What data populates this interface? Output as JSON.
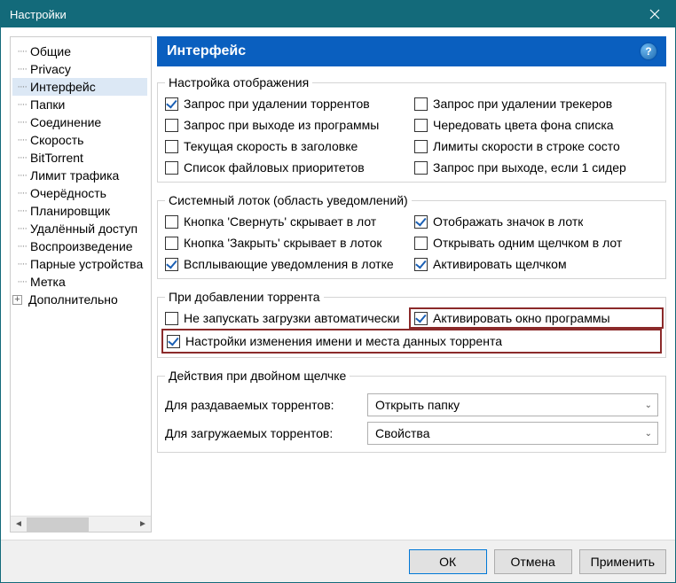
{
  "window": {
    "title": "Настройки"
  },
  "sidebar": {
    "items": [
      {
        "label": "Общие",
        "expandable": false
      },
      {
        "label": "Privacy",
        "expandable": false
      },
      {
        "label": "Интерфейс",
        "expandable": false,
        "selected": true
      },
      {
        "label": "Папки",
        "expandable": false
      },
      {
        "label": "Соединение",
        "expandable": false
      },
      {
        "label": "Скорость",
        "expandable": false
      },
      {
        "label": "BitTorrent",
        "expandable": false
      },
      {
        "label": "Лимит трафика",
        "expandable": false
      },
      {
        "label": "Очерёдность",
        "expandable": false
      },
      {
        "label": "Планировщик",
        "expandable": false
      },
      {
        "label": "Удалённый доступ",
        "expandable": false
      },
      {
        "label": "Воспроизведение",
        "expandable": false
      },
      {
        "label": "Парные устройства",
        "expandable": false
      },
      {
        "label": "Метка",
        "expandable": false
      },
      {
        "label": "Дополнительно",
        "expandable": true
      }
    ]
  },
  "panel": {
    "title": "Интерфейс"
  },
  "groups": {
    "display": {
      "title": "Настройка отображения",
      "items": [
        {
          "label": "Запрос при удалении торрентов",
          "checked": true
        },
        {
          "label": "Запрос при удалении трекеров",
          "checked": false
        },
        {
          "label": "Запрос при выходе из программы",
          "checked": false
        },
        {
          "label": "Чередовать цвета фона списка",
          "checked": false
        },
        {
          "label": "Текущая скорость в заголовке",
          "checked": false
        },
        {
          "label": "Лимиты скорости в строке состо",
          "checked": false
        },
        {
          "label": "Список файловых приоритетов",
          "checked": false
        },
        {
          "label": "Запрос при выходе, если 1 сидер",
          "checked": false
        }
      ]
    },
    "tray": {
      "title": "Системный лоток (область уведомлений)",
      "items": [
        {
          "label": "Кнопка 'Свернуть' скрывает в лот",
          "checked": false
        },
        {
          "label": "Отображать значок в лотк",
          "checked": true
        },
        {
          "label": "Кнопка 'Закрыть' скрывает в лоток",
          "checked": false
        },
        {
          "label": "Открывать одним щелчком в лот",
          "checked": false
        },
        {
          "label": "Всплывающие уведомления в лотке",
          "checked": true
        },
        {
          "label": "Активировать щелчком",
          "checked": true
        }
      ]
    },
    "adding": {
      "title": "При добавлении торрента",
      "items": [
        {
          "label": "Не запускать загрузки автоматически",
          "checked": false
        },
        {
          "label": "Активировать окно программы",
          "checked": true,
          "highlighted": true
        },
        {
          "label": "Настройки изменения имени и места данных торрента",
          "checked": true,
          "highlighted_full": true
        }
      ]
    },
    "dblclick": {
      "title": "Действия при двойном щелчке",
      "rows": [
        {
          "label": "Для раздаваемых торрентов:",
          "value": "Открыть папку"
        },
        {
          "label": "Для загружаемых торрентов:",
          "value": "Свойства"
        }
      ]
    }
  },
  "buttons": {
    "ok": "ОК",
    "cancel": "Отмена",
    "apply": "Применить"
  }
}
